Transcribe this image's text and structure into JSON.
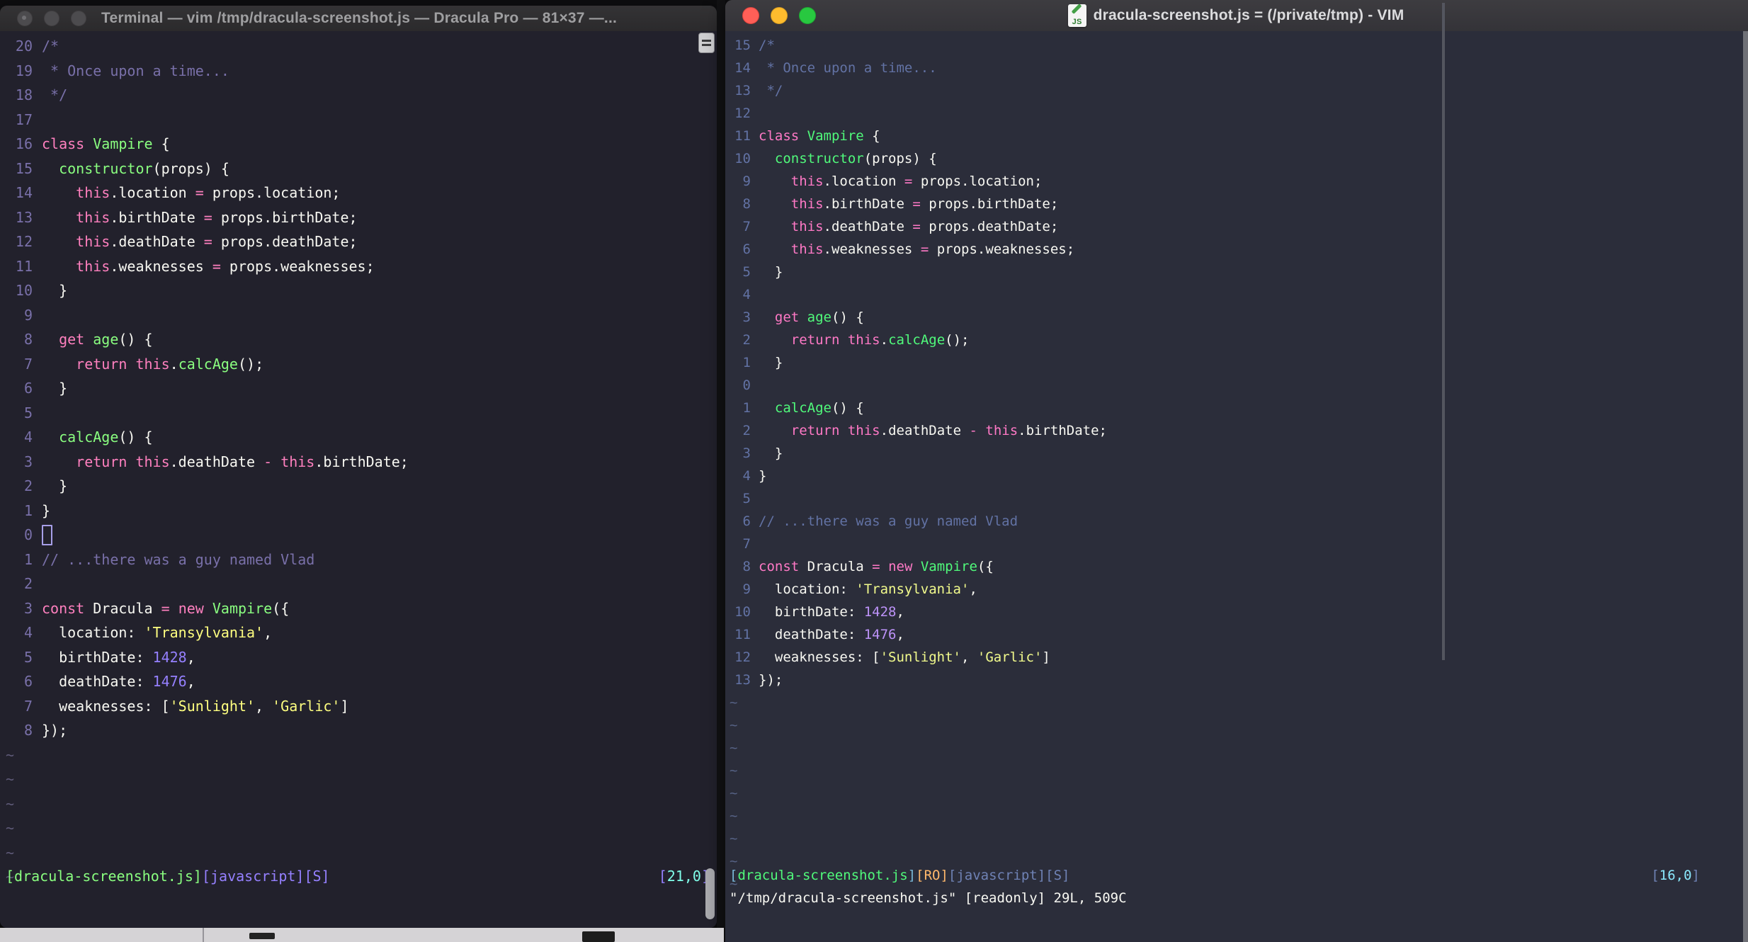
{
  "left_window": {
    "title": "Terminal — vim /tmp/dracula-screenshot.js — Dracula Pro — 81×37 —...",
    "theme": "Dracula Pro",
    "palette": {
      "bg": "#22212C",
      "f": "#F8F8F2",
      "p": "#FF80BF",
      "g": "#8AFF80",
      "y": "#FFFF80",
      "u": "#9580FF",
      "c": "#7970A9",
      "cy": "#80FFEA",
      "n": "#7970A9",
      "tilde": "#5E5A78"
    },
    "lines": [
      {
        "num": "20",
        "t": [
          [
            "c",
            "/*"
          ]
        ]
      },
      {
        "num": "19",
        "t": [
          [
            "c",
            " * Once upon a time..."
          ]
        ]
      },
      {
        "num": "18",
        "t": [
          [
            "c",
            " */"
          ]
        ]
      },
      {
        "num": "17",
        "t": []
      },
      {
        "num": "16",
        "t": [
          [
            "p",
            "class"
          ],
          [
            "f",
            " "
          ],
          [
            "g",
            "Vampire"
          ],
          [
            "f",
            " {"
          ]
        ]
      },
      {
        "num": "15",
        "t": [
          [
            "f",
            "  "
          ],
          [
            "g",
            "constructor"
          ],
          [
            "f",
            "(props) {"
          ]
        ]
      },
      {
        "num": "14",
        "t": [
          [
            "f",
            "    "
          ],
          [
            "p",
            "this"
          ],
          [
            "f",
            ".location "
          ],
          [
            "p",
            "="
          ],
          [
            "f",
            " props.location;"
          ]
        ]
      },
      {
        "num": "13",
        "t": [
          [
            "f",
            "    "
          ],
          [
            "p",
            "this"
          ],
          [
            "f",
            ".birthDate "
          ],
          [
            "p",
            "="
          ],
          [
            "f",
            " props.birthDate;"
          ]
        ]
      },
      {
        "num": "12",
        "t": [
          [
            "f",
            "    "
          ],
          [
            "p",
            "this"
          ],
          [
            "f",
            ".deathDate "
          ],
          [
            "p",
            "="
          ],
          [
            "f",
            " props.deathDate;"
          ]
        ]
      },
      {
        "num": "11",
        "t": [
          [
            "f",
            "    "
          ],
          [
            "p",
            "this"
          ],
          [
            "f",
            ".weaknesses "
          ],
          [
            "p",
            "="
          ],
          [
            "f",
            " props.weaknesses;"
          ]
        ]
      },
      {
        "num": "10",
        "t": [
          [
            "f",
            "  }"
          ]
        ]
      },
      {
        "num": "9",
        "t": []
      },
      {
        "num": "8",
        "t": [
          [
            "f",
            "  "
          ],
          [
            "p",
            "get"
          ],
          [
            "f",
            " "
          ],
          [
            "g",
            "age"
          ],
          [
            "f",
            "() {"
          ]
        ]
      },
      {
        "num": "7",
        "t": [
          [
            "f",
            "    "
          ],
          [
            "p",
            "return"
          ],
          [
            "f",
            " "
          ],
          [
            "p",
            "this"
          ],
          [
            "f",
            "."
          ],
          [
            "g",
            "calcAge"
          ],
          [
            "f",
            "();"
          ]
        ]
      },
      {
        "num": "6",
        "t": [
          [
            "f",
            "  }"
          ]
        ]
      },
      {
        "num": "5",
        "t": []
      },
      {
        "num": "4",
        "t": [
          [
            "f",
            "  "
          ],
          [
            "g",
            "calcAge"
          ],
          [
            "f",
            "() {"
          ]
        ]
      },
      {
        "num": "3",
        "t": [
          [
            "f",
            "    "
          ],
          [
            "p",
            "return"
          ],
          [
            "f",
            " "
          ],
          [
            "p",
            "this"
          ],
          [
            "f",
            ".deathDate "
          ],
          [
            "p",
            "-"
          ],
          [
            "f",
            " "
          ],
          [
            "p",
            "this"
          ],
          [
            "f",
            ".birthDate;"
          ]
        ]
      },
      {
        "num": "2",
        "t": [
          [
            "f",
            "  }"
          ]
        ]
      },
      {
        "num": "1",
        "t": [
          [
            "f",
            "}"
          ]
        ]
      },
      {
        "num": "0",
        "t": [
          [
            "cur",
            ""
          ]
        ]
      },
      {
        "num": "1",
        "t": [
          [
            "c",
            "// ...there was a guy named Vlad"
          ]
        ]
      },
      {
        "num": "2",
        "t": []
      },
      {
        "num": "3",
        "t": [
          [
            "p",
            "const"
          ],
          [
            "f",
            " Dracula "
          ],
          [
            "p",
            "="
          ],
          [
            "f",
            " "
          ],
          [
            "p",
            "new"
          ],
          [
            "f",
            " "
          ],
          [
            "g",
            "Vampire"
          ],
          [
            "f",
            "({"
          ]
        ]
      },
      {
        "num": "4",
        "t": [
          [
            "f",
            "  location: "
          ],
          [
            "y",
            "'Transylvania'"
          ],
          [
            "f",
            ","
          ]
        ]
      },
      {
        "num": "5",
        "t": [
          [
            "f",
            "  birthDate: "
          ],
          [
            "u",
            "1428"
          ],
          [
            "f",
            ","
          ]
        ]
      },
      {
        "num": "6",
        "t": [
          [
            "f",
            "  deathDate: "
          ],
          [
            "u",
            "1476"
          ],
          [
            "f",
            ","
          ]
        ]
      },
      {
        "num": "7",
        "t": [
          [
            "f",
            "  weaknesses: ["
          ],
          [
            "y",
            "'Sunlight'"
          ],
          [
            "f",
            ", "
          ],
          [
            "y",
            "'Garlic'"
          ],
          [
            "f",
            "]"
          ]
        ]
      },
      {
        "num": "8",
        "t": [
          [
            "f",
            "});"
          ]
        ]
      }
    ],
    "tilde_rows": 6,
    "statusline": {
      "left": [
        [
          "g",
          "[dracula-screenshot.js]"
        ],
        [
          "u",
          "[javascript][S]"
        ]
      ],
      "ruler": [
        [
          "u",
          "["
        ],
        [
          "cy",
          "21,0"
        ],
        [
          "u",
          "]"
        ]
      ]
    }
  },
  "right_window": {
    "title": "dracula-screenshot.js = (/private/tmp) - VIM",
    "theme": "Dracula",
    "file_icon": "JS",
    "palette": {
      "bg": "#2B2D3A",
      "f": "#F8F8F2",
      "p": "#FF79C6",
      "g": "#50FA7B",
      "y": "#F1FA8C",
      "u": "#BD93F9",
      "c": "#6272A4",
      "o": "#FFB86C",
      "cy": "#8BE9FD",
      "sb": "#79B8D8",
      "sc": "#6F82B5",
      "n": "#6272A4",
      "tilde": "#566285"
    },
    "lines": [
      {
        "num": "15",
        "t": [
          [
            "c",
            "/*"
          ]
        ]
      },
      {
        "num": "14",
        "t": [
          [
            "c",
            " * Once upon a time..."
          ]
        ]
      },
      {
        "num": "13",
        "t": [
          [
            "c",
            " */"
          ]
        ]
      },
      {
        "num": "12",
        "t": []
      },
      {
        "num": "11",
        "t": [
          [
            "p",
            "class"
          ],
          [
            "f",
            " "
          ],
          [
            "g",
            "Vampire"
          ],
          [
            "f",
            " {"
          ]
        ]
      },
      {
        "num": "10",
        "t": [
          [
            "f",
            "  "
          ],
          [
            "g",
            "constructor"
          ],
          [
            "f",
            "(props) {"
          ]
        ]
      },
      {
        "num": "9",
        "t": [
          [
            "f",
            "    "
          ],
          [
            "p",
            "this"
          ],
          [
            "f",
            ".location "
          ],
          [
            "p",
            "="
          ],
          [
            "f",
            " props.location;"
          ]
        ]
      },
      {
        "num": "8",
        "t": [
          [
            "f",
            "    "
          ],
          [
            "p",
            "this"
          ],
          [
            "f",
            ".birthDate "
          ],
          [
            "p",
            "="
          ],
          [
            "f",
            " props.birthDate;"
          ]
        ]
      },
      {
        "num": "7",
        "t": [
          [
            "f",
            "    "
          ],
          [
            "p",
            "this"
          ],
          [
            "f",
            ".deathDate "
          ],
          [
            "p",
            "="
          ],
          [
            "f",
            " props.deathDate;"
          ]
        ]
      },
      {
        "num": "6",
        "t": [
          [
            "f",
            "    "
          ],
          [
            "p",
            "this"
          ],
          [
            "f",
            ".weaknesses "
          ],
          [
            "p",
            "="
          ],
          [
            "f",
            " props.weaknesses;"
          ]
        ]
      },
      {
        "num": "5",
        "t": [
          [
            "f",
            "  }"
          ]
        ]
      },
      {
        "num": "4",
        "t": []
      },
      {
        "num": "3",
        "t": [
          [
            "f",
            "  "
          ],
          [
            "p",
            "get"
          ],
          [
            "f",
            " "
          ],
          [
            "g",
            "age"
          ],
          [
            "f",
            "() {"
          ]
        ]
      },
      {
        "num": "2",
        "t": [
          [
            "f",
            "    "
          ],
          [
            "p",
            "return"
          ],
          [
            "f",
            " "
          ],
          [
            "p",
            "this"
          ],
          [
            "f",
            "."
          ],
          [
            "g",
            "calcAge"
          ],
          [
            "f",
            "();"
          ]
        ]
      },
      {
        "num": "1",
        "t": [
          [
            "f",
            "  }"
          ]
        ]
      },
      {
        "num": "0",
        "t": []
      },
      {
        "num": "1",
        "t": [
          [
            "f",
            "  "
          ],
          [
            "g",
            "calcAge"
          ],
          [
            "f",
            "() {"
          ]
        ]
      },
      {
        "num": "2",
        "t": [
          [
            "f",
            "    "
          ],
          [
            "p",
            "return"
          ],
          [
            "f",
            " "
          ],
          [
            "p",
            "this"
          ],
          [
            "f",
            ".deathDate "
          ],
          [
            "p",
            "-"
          ],
          [
            "f",
            " "
          ],
          [
            "p",
            "this"
          ],
          [
            "f",
            ".birthDate;"
          ]
        ]
      },
      {
        "num": "3",
        "t": [
          [
            "f",
            "  }"
          ]
        ]
      },
      {
        "num": "4",
        "t": [
          [
            "f",
            "}"
          ]
        ]
      },
      {
        "num": "5",
        "t": []
      },
      {
        "num": "6",
        "t": [
          [
            "c",
            "// ...there was a guy named Vlad"
          ]
        ]
      },
      {
        "num": "7",
        "t": []
      },
      {
        "num": "8",
        "t": [
          [
            "p",
            "const"
          ],
          [
            "f",
            " Dracula "
          ],
          [
            "p",
            "="
          ],
          [
            "f",
            " "
          ],
          [
            "p",
            "new"
          ],
          [
            "f",
            " "
          ],
          [
            "g",
            "Vampire"
          ],
          [
            "f",
            "({"
          ]
        ]
      },
      {
        "num": "9",
        "t": [
          [
            "f",
            "  location: "
          ],
          [
            "y",
            "'Transylvania'"
          ],
          [
            "f",
            ","
          ]
        ]
      },
      {
        "num": "10",
        "t": [
          [
            "f",
            "  birthDate: "
          ],
          [
            "u",
            "1428"
          ],
          [
            "f",
            ","
          ]
        ]
      },
      {
        "num": "11",
        "t": [
          [
            "f",
            "  deathDate: "
          ],
          [
            "u",
            "1476"
          ],
          [
            "f",
            ","
          ]
        ]
      },
      {
        "num": "12",
        "t": [
          [
            "f",
            "  weaknesses: ["
          ],
          [
            "y",
            "'Sunlight'"
          ],
          [
            "f",
            ", "
          ],
          [
            "y",
            "'Garlic'"
          ],
          [
            "f",
            "]"
          ]
        ]
      },
      {
        "num": "13",
        "t": [
          [
            "f",
            "});"
          ]
        ]
      }
    ],
    "tilde_rows": 9,
    "statusline": {
      "left": [
        [
          "sb",
          "["
        ],
        [
          "g",
          "dracula-screenshot.js"
        ],
        [
          "sb",
          "]"
        ],
        [
          "o",
          "[RO]"
        ],
        [
          "sc",
          "[javascript][S]"
        ]
      ],
      "ruler": [
        [
          "sc",
          "["
        ],
        [
          "cy",
          "16,0"
        ],
        [
          "sc",
          "]"
        ]
      ]
    },
    "message_line": "\"/tmp/dracula-screenshot.js\" [readonly] 29L, 509C"
  }
}
